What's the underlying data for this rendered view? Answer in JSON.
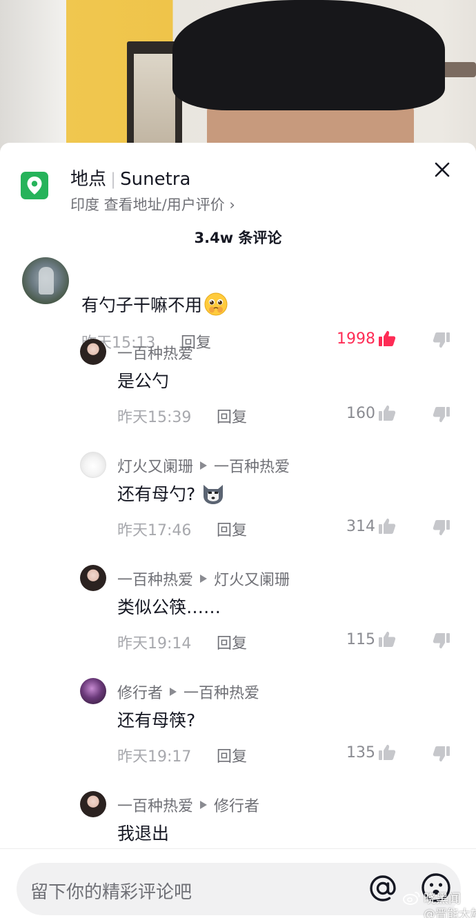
{
  "poi": {
    "label": "地点",
    "name": "Sunetra",
    "subtitle": "印度  查看地址/用户评价 ›"
  },
  "comments_header": {
    "count_text": "3.4w 条评论"
  },
  "main_comment": {
    "author_partial": "一 · ~ ·",
    "text": "有勺子干嘛不用",
    "time": "昨天15:13",
    "reply_label": "回复",
    "likes": "1998",
    "liked": true
  },
  "replies": [
    {
      "author": "一百种热爱",
      "reply_to": "",
      "text": "是公勺",
      "time": "昨天15:39",
      "reply_label": "回复",
      "likes": "160",
      "avatar": "girl-avatar"
    },
    {
      "author": "灯火又阑珊",
      "reply_to": "一百种热爱",
      "text": "还有母勺?",
      "time": "昨天17:46",
      "reply_label": "回复",
      "likes": "314",
      "avatar": "white-avatar"
    },
    {
      "author": "一百种热爱",
      "reply_to": "灯火又阑珊",
      "text": "类似公筷……",
      "time": "昨天19:14",
      "reply_label": "回复",
      "likes": "115",
      "avatar": "girl-avatar"
    },
    {
      "author": "修行者",
      "reply_to": "一百种热爱",
      "text": "还有母筷?",
      "time": "昨天19:17",
      "reply_label": "回复",
      "likes": "135",
      "avatar": "purple-avatar"
    },
    {
      "author": "一百种热爱",
      "reply_to": "修行者",
      "text": "我退出",
      "time": "",
      "reply_label": "",
      "likes": "",
      "avatar": "girl-avatar"
    }
  ],
  "input": {
    "placeholder": "留下你的精彩评论吧"
  },
  "watermark": {
    "line1": "晓黑闻",
    "line2": "@晋能大雄"
  },
  "icons": [
    "location-pin-icon",
    "close-icon",
    "thumb-up-icon",
    "thumb-down-icon",
    "at-icon",
    "emoji-icon",
    "pleading-face-emoji",
    "husky-emoji",
    "weibo-icon"
  ],
  "colors": {
    "accent_like": "#fe2c55",
    "poi_green": "#26b35a",
    "text_primary": "#161823",
    "text_secondary": "#a7a8ad"
  }
}
